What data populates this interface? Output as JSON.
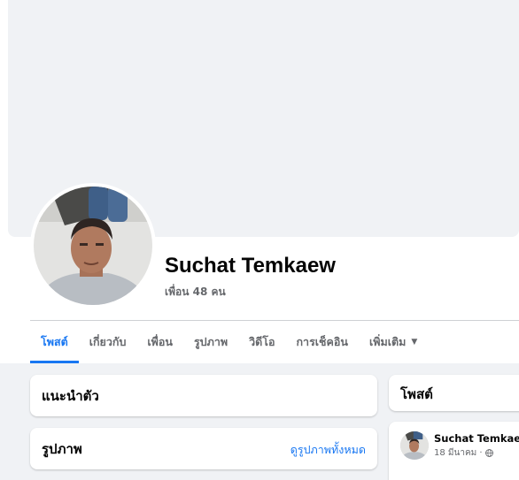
{
  "profile": {
    "name": "Suchat Temkaew",
    "friends_text": "เพื่อน 48 คน"
  },
  "tabs": [
    {
      "label": "โพสต์",
      "active": true
    },
    {
      "label": "เกี่ยวกับ",
      "active": false
    },
    {
      "label": "เพื่อน",
      "active": false
    },
    {
      "label": "รูปภาพ",
      "active": false
    },
    {
      "label": "วิดีโอ",
      "active": false
    },
    {
      "label": "การเช็คอิน",
      "active": false
    },
    {
      "label": "เพิ่มเติม",
      "active": false,
      "icon": "caret-down-icon"
    }
  ],
  "intro": {
    "title": "แนะนำตัว"
  },
  "photos": {
    "title": "รูปภาพ",
    "see_all": "ดูรูปภาพทั้งหมด"
  },
  "posts": {
    "title": "โพสต์"
  },
  "post": {
    "author": "Suchat Temkaew",
    "date": "18 มีนาคม ·",
    "privacy_icon": "globe-icon"
  },
  "colors": {
    "accent": "#1877f2",
    "background": "#f0f2f5",
    "secondary_text": "#65676b"
  }
}
